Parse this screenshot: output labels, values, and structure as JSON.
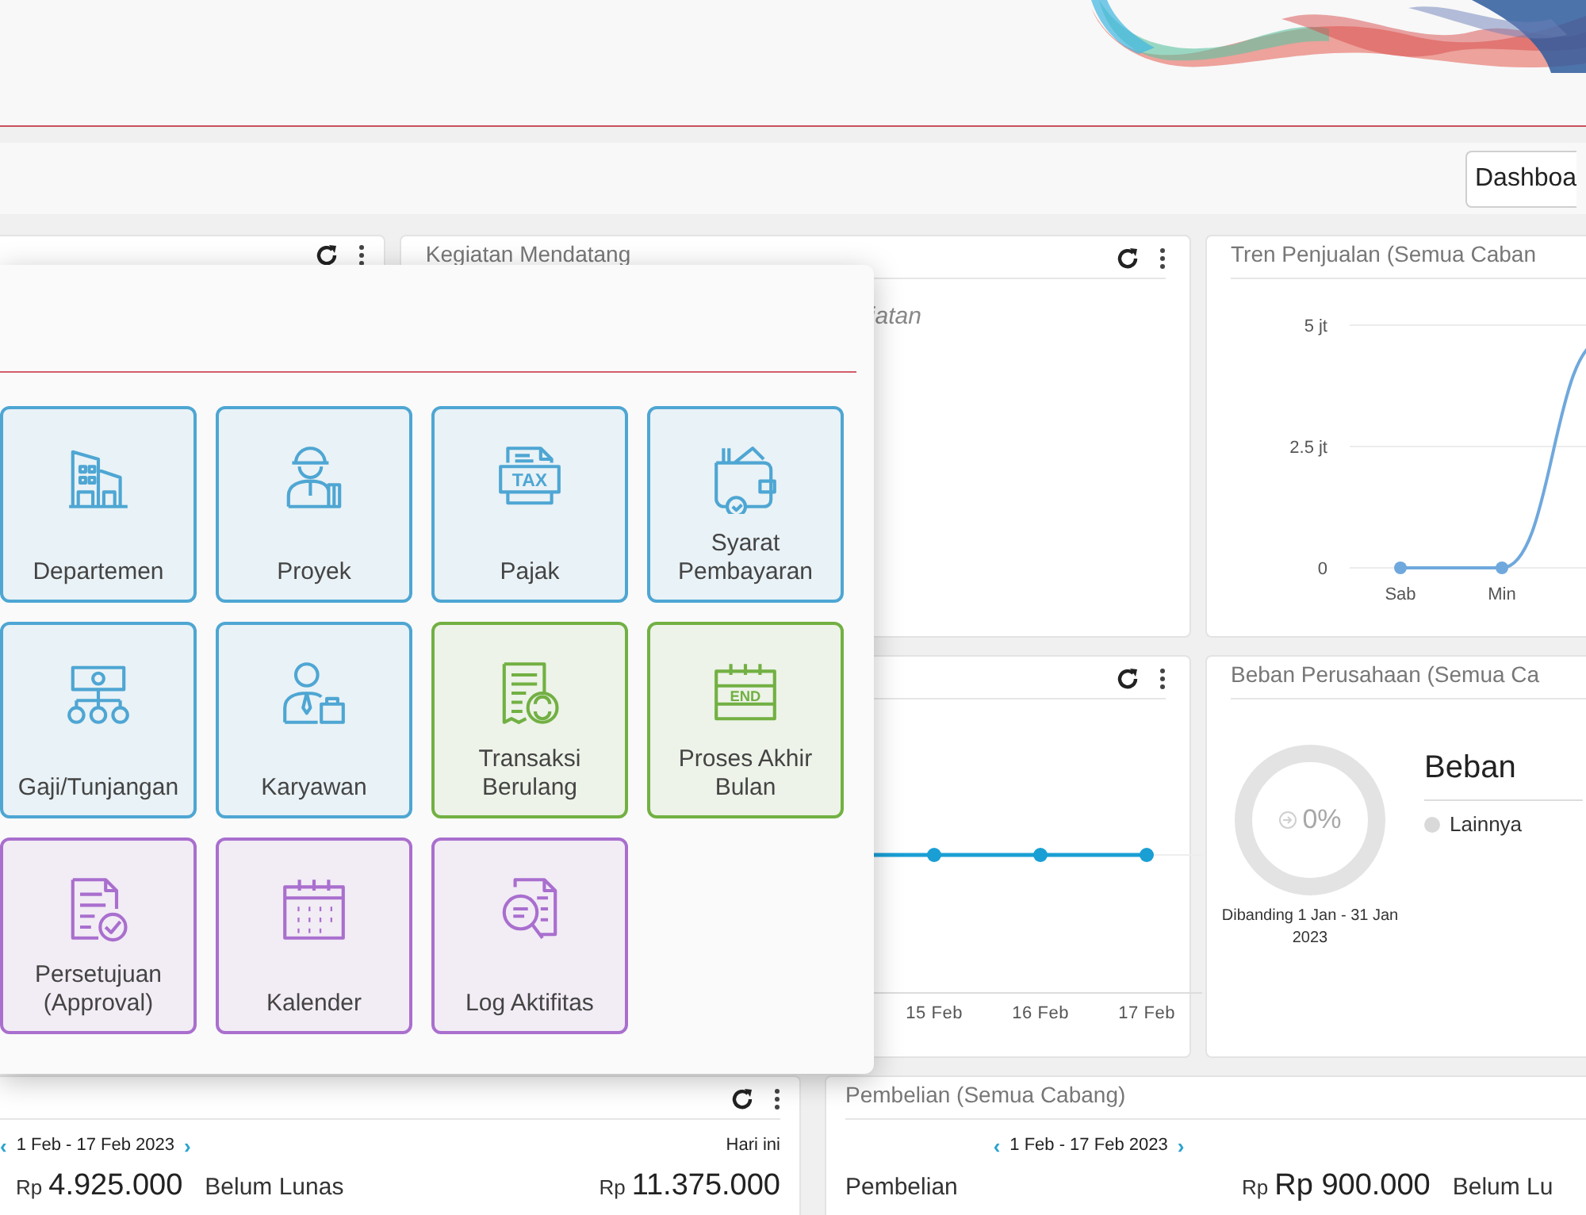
{
  "toolbar": {
    "dashboard_button": "Dashboa"
  },
  "cards": {
    "upcoming": {
      "title": "Kegiatan Mendatang",
      "empty_text": "iatan"
    },
    "sales_trend": {
      "title": "Tren Penjualan (Semua Caban",
      "chart_data": {
        "type": "line",
        "categories": [
          "Sab",
          "Min",
          null
        ],
        "yticks": [
          {
            "value": 0,
            "label": "0"
          },
          {
            "value": 2.5,
            "label": "2.5 jt"
          },
          {
            "value": 5,
            "label": "5 jt"
          }
        ],
        "ylim": [
          0,
          5
        ],
        "series": [
          {
            "color": "#6fa8dc",
            "marker": true,
            "values": [
              0,
              0,
              4.7
            ]
          }
        ]
      }
    },
    "daily_chart": {
      "x_labels": [
        "15 Feb",
        "16 Feb",
        "17 Feb"
      ]
    },
    "expenses": {
      "title": "Beban Perusahaan (Semua Ca",
      "donut_value": "0%",
      "compare_text": "Dibanding 1 Jan - 31 Jan 2023",
      "legend_title": "Beban",
      "legend": [
        {
          "label": "Lainnya",
          "color": "#d9d9d9"
        }
      ]
    },
    "receivables": {
      "prev": "‹",
      "range": "1 Feb - 17 Feb 2023",
      "next": "›",
      "today": "Hari ini",
      "paid_currency": "Rp",
      "paid_amount": "4.925.000",
      "unpaid_label": "Belum Lunas",
      "unpaid_currency": "Rp",
      "unpaid_amount": "11.375.000"
    },
    "purchases": {
      "title": "Pembelian (Semua Cabang)",
      "prev": "‹",
      "range": "1 Feb - 17 Feb 2023",
      "next": "›",
      "label": "Pembelian",
      "currency": "Rp",
      "amount": "Rp 900.000",
      "unpaid_label": "Belum Lu"
    }
  },
  "menu": {
    "tiles": [
      {
        "label": "Departemen",
        "color": "#4ea6d3"
      },
      {
        "label": "Proyek",
        "color": "#4ea6d3"
      },
      {
        "label": "Pajak",
        "color": "#4ea6d3",
        "icon_text": "TAX"
      },
      {
        "label": "Syarat Pembayaran",
        "color": "#4ea6d3"
      },
      {
        "label": "Gaji/Tunjangan",
        "color": "#4ea6d3"
      },
      {
        "label": "Karyawan",
        "color": "#4ea6d3"
      },
      {
        "label": "Transaksi Berulang",
        "color": "#72b043"
      },
      {
        "label": "Proses Akhir Bulan",
        "color": "#72b043",
        "icon_text": "END"
      },
      {
        "label": "Persetujuan (Approval)",
        "color": "#a96fce"
      },
      {
        "label": "Kalender",
        "color": "#a96fce"
      },
      {
        "label": "Log Aktifitas",
        "color": "#a96fce"
      }
    ]
  }
}
